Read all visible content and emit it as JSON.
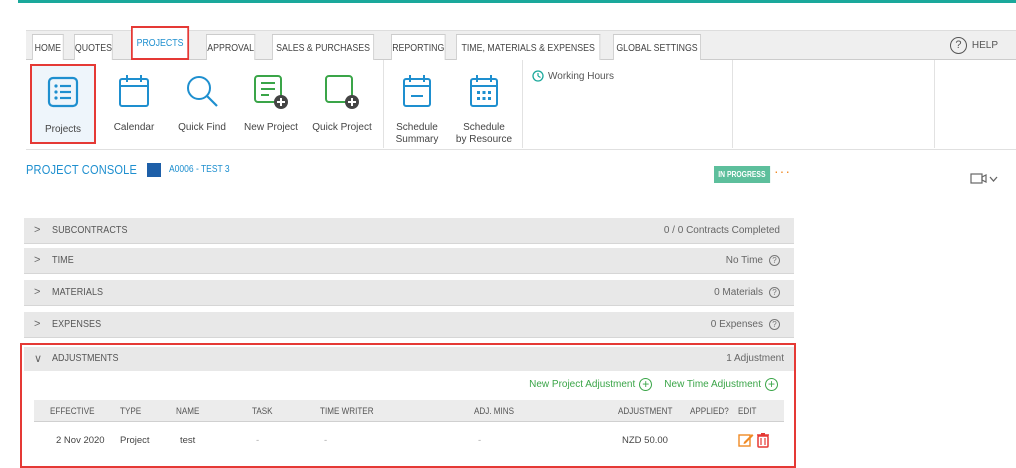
{
  "tabs": [
    "HOME",
    "QUOTES",
    "PROJECTS",
    "APPROVAL",
    "SALES & PURCHASES",
    "REPORTING",
    "TIME, MATERIALS & EXPENSES",
    "GLOBAL SETTINGS"
  ],
  "active_tab": "PROJECTS",
  "help_label": "HELP",
  "ribbon": {
    "buttons": [
      "Projects",
      "Calendar",
      "Quick Find",
      "New Project",
      "Quick Project"
    ],
    "schedule_summary": [
      "Schedule",
      "Summary"
    ],
    "schedule_resource": [
      "Schedule",
      "by Resource"
    ],
    "working_hours": "Working Hours"
  },
  "console": {
    "title": "PROJECT CONSOLE",
    "project_code": "A0006 - TEST 3",
    "status": "IN PROGRESS",
    "more": "···"
  },
  "sections": [
    {
      "name": "SUBCONTRACTS",
      "status": "0 / 0 Contracts Completed"
    },
    {
      "name": "TIME",
      "status": "No Time"
    },
    {
      "name": "MATERIALS",
      "status": "0 Materials"
    },
    {
      "name": "EXPENSES",
      "status": "0 Expenses"
    }
  ],
  "adjustments": {
    "name": "ADJUSTMENTS",
    "count": "1 Adjustment",
    "new_project_adj": "New Project Adjustment",
    "new_time_adj": "New Time Adjustment",
    "columns": [
      "EFFECTIVE",
      "TYPE",
      "NAME",
      "TASK",
      "TIME WRITER",
      "ADJ. MINS",
      "ADJUSTMENT",
      "APPLIED?",
      "EDIT"
    ],
    "rows": [
      {
        "effective": "2 Nov 2020",
        "type": "Project",
        "name": "test",
        "task": "-",
        "writer": "-",
        "mins": "-",
        "adjustment": "NZD 50.00"
      }
    ]
  },
  "colors": {
    "accent": "#1e8fcf",
    "highlight": "#e53935",
    "teal": "#1aa89b",
    "green": "#3aa548",
    "badge": "#5dbf9c"
  }
}
